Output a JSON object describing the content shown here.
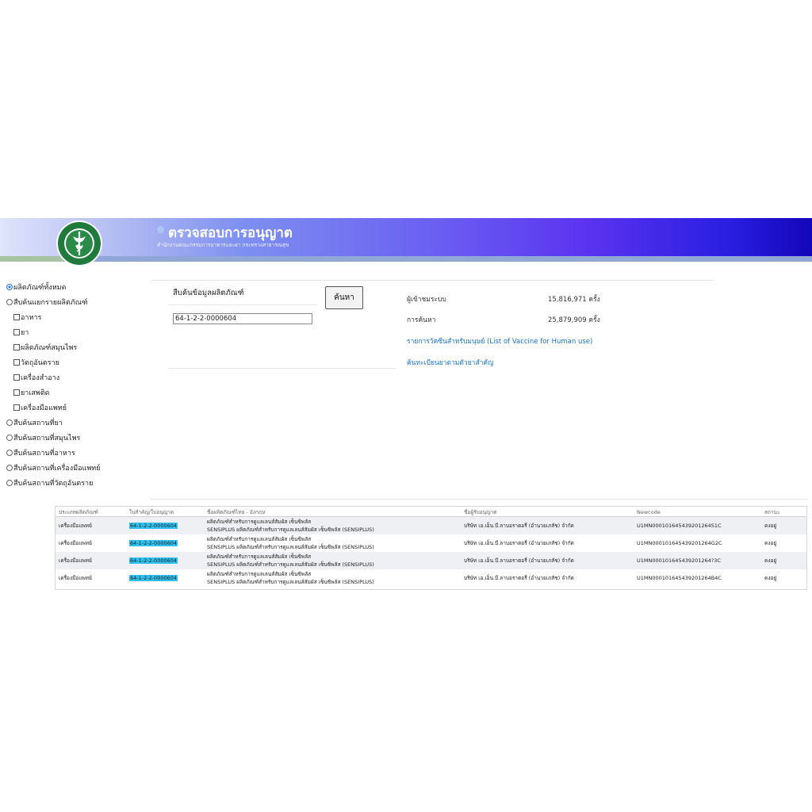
{
  "header": {
    "title": "ตรวจสอบการอนุญาต",
    "subtitle": "สำนักงานคณะกรรมการอาหารและยา  กระทรวงสาธารณสุข",
    "logo_text": "กระทรวงสาธารณสุข MINISTRY OF PUBLIC HEALTH"
  },
  "sidebar": {
    "radios": [
      {
        "label": "ผลิตภัณฑ์ทั้งหมด",
        "checked": true
      },
      {
        "label": "สืบค้นแยกรายผลิตภัณฑ์",
        "checked": false
      }
    ],
    "checkboxes": [
      {
        "label": "อาหาร"
      },
      {
        "label": "ยา"
      },
      {
        "label": "ผลิตภัณฑ์สมุนไพร"
      },
      {
        "label": "วัตถุอันตราย"
      },
      {
        "label": "เครื่องสำอาง"
      },
      {
        "label": "ยาเสพติด"
      },
      {
        "label": "เครื่องมือแพทย์"
      }
    ],
    "radios_bottom": [
      {
        "label": "สืบค้นสถานที่ยา"
      },
      {
        "label": "สืบค้นสถานที่สมุนไพร"
      },
      {
        "label": "สืบค้นสถานที่อาหาร"
      },
      {
        "label": "สืบค้นสถานที่เครื่องมือแพทย์"
      },
      {
        "label": "สืบค้นสถานที่วัตถุอันตราย"
      }
    ]
  },
  "search": {
    "label": "สืบค้นข้อมูลผลิตภัณฑ์",
    "value": "64-1-2-2-0000604",
    "button": "ค้นหา"
  },
  "stats": {
    "visitors_label": "ผู้เข้าชมระบบ",
    "visitors_value": "15,816,971 ครั้ง",
    "searches_label": "การค้นหา",
    "searches_value": "25,879,909 ครั้ง",
    "link_vaccine": "รายการวัคซีนสำหรับมนุษย์ (List of Vaccine for Human use)",
    "link_drug": "ค้นทะเบียนยาตามตัวยาสำคัญ"
  },
  "results": {
    "headers": [
      "ประเภทผลิตภัณฑ์",
      "ใบสำคัญ/ใบอนุญาต",
      "ชื่อผลิตภัณฑ์ไทย - อังกฤษ",
      "ชื่อผู้รับอนุญาต",
      "Newcode",
      "สถานะ"
    ],
    "rows": [
      {
        "type": "เครื่องมือแพทย์",
        "license": "64-1-2-2-0000604",
        "name1": "ผลิตภัณฑ์สำหรับการดูแลเลนส์สัมผัส เซ็นซิพลัส",
        "name2": "SENSIPLUS ผลิตภัณฑ์สำหรับการดูแลเลนส์สัมผัส เซ็นซิพลัส (SENSIPLUS)",
        "holder": "บริษัท เอ.เอ็น.บี.ลาบอราตอรี่ (อำนวยเภสัช) จำกัด",
        "newcode": "U1MN000101645439201264S1C",
        "status": "คงอยู่"
      },
      {
        "type": "เครื่องมือแพทย์",
        "license": "64-1-2-2-0000604",
        "name1": "ผลิตภัณฑ์สำหรับการดูแลเลนส์สัมผัส เซ็นซิพลัส",
        "name2": "SENSIPLUS ผลิตภัณฑ์สำหรับการดูแลเลนส์สัมผัส เซ็นซิพลัส (SENSIPLUS)",
        "holder": "บริษัท เอ.เอ็น.บี.ลาบอราตอรี่ (อำนวยเภสัช) จำกัด",
        "newcode": "U1MN000101645439201264G2C",
        "status": "คงอยู่"
      },
      {
        "type": "เครื่องมือแพทย์",
        "license": "64-1-2-2-0000604",
        "name1": "ผลิตภัณฑ์สำหรับการดูแลเลนส์สัมผัส เซ็นซิพลัส",
        "name2": "SENSIPLUS ผลิตภัณฑ์สำหรับการดูแลเลนส์สัมผัส เซ็นซิพลัส (SENSIPLUS)",
        "holder": "บริษัท เอ.เอ็น.บี.ลาบอราตอรี่ (อำนวยเภสัช) จำกัด",
        "newcode": "U1MN000101645439201264?3C",
        "status": "คงอยู่"
      },
      {
        "type": "เครื่องมือแพทย์",
        "license": "64-1-2-2-0000604",
        "name1": "ผลิตภัณฑ์สำหรับการดูแลเลนส์สัมผัส เซ็นซิพลัส",
        "name2": "SENSIPLUS ผลิตภัณฑ์สำหรับการดูแลเลนส์สัมผัส เซ็นซิพลัส (SENSIPLUS)",
        "holder": "บริษัท เอ.เอ็น.บี.ลาบอราตอรี่ (อำนวยเภสัช) จำกัด",
        "newcode": "U1MN000101645439201264B4C",
        "status": "คงอยู่"
      }
    ]
  },
  "colors": {
    "banner_start": "#dfe4fb",
    "banner_end": "#1406b8",
    "link": "#1a73c9",
    "license_highlight": "#33c0ea"
  }
}
